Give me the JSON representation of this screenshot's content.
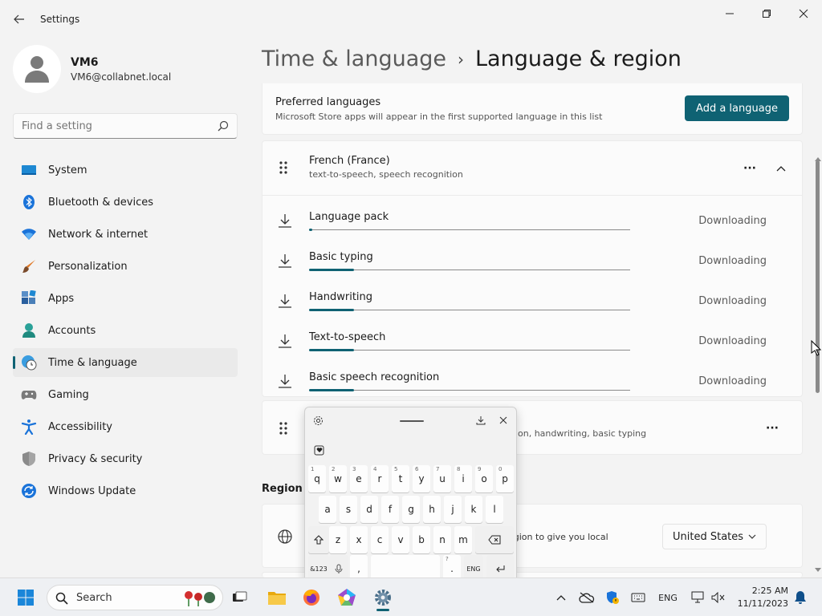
{
  "window": {
    "title": "Settings"
  },
  "profile": {
    "name": "VM6",
    "email": "VM6@collabnet.local"
  },
  "search": {
    "placeholder": "Find a setting"
  },
  "nav": {
    "items": [
      {
        "label": "System",
        "icon": "system-icon",
        "active": false
      },
      {
        "label": "Bluetooth & devices",
        "icon": "bluetooth-icon",
        "active": false
      },
      {
        "label": "Network & internet",
        "icon": "wifi-icon",
        "active": false
      },
      {
        "label": "Personalization",
        "icon": "brush-icon",
        "active": false
      },
      {
        "label": "Apps",
        "icon": "apps-icon",
        "active": false
      },
      {
        "label": "Accounts",
        "icon": "accounts-icon",
        "active": false
      },
      {
        "label": "Time & language",
        "icon": "globe-clock-icon",
        "active": true
      },
      {
        "label": "Gaming",
        "icon": "gamepad-icon",
        "active": false
      },
      {
        "label": "Accessibility",
        "icon": "accessibility-icon",
        "active": false
      },
      {
        "label": "Privacy & security",
        "icon": "shield-icon",
        "active": false
      },
      {
        "label": "Windows Update",
        "icon": "update-icon",
        "active": false
      }
    ]
  },
  "breadcrumb": {
    "parent": "Time & language",
    "separator": "›",
    "current": "Language & region"
  },
  "preferred": {
    "title": "Preferred languages",
    "subtitle": "Microsoft Store apps will appear in the first supported language in this list",
    "add_button": "Add a language"
  },
  "language1": {
    "name": "French (France)",
    "features": "text-to-speech, speech recognition",
    "more": "···",
    "downloads": [
      {
        "label": "Language pack",
        "status": "Downloading",
        "progress": 0.01
      },
      {
        "label": "Basic typing",
        "status": "Downloading",
        "progress": 0.14
      },
      {
        "label": "Handwriting",
        "status": "Downloading",
        "progress": 0.14
      },
      {
        "label": "Text-to-speech",
        "status": "Downloading",
        "progress": 0.14
      },
      {
        "label": "Basic speech recognition",
        "status": "Downloading",
        "progress": 0.14
      }
    ]
  },
  "language2": {
    "features": "on, handwriting, basic typing",
    "more": "···"
  },
  "region": {
    "label": "Region",
    "text": "egion to give you local",
    "country": "United States"
  },
  "keyboard": {
    "row1": [
      [
        "q",
        "1"
      ],
      [
        "w",
        "2"
      ],
      [
        "e",
        "3"
      ],
      [
        "r",
        "4"
      ],
      [
        "t",
        "5"
      ],
      [
        "y",
        "6"
      ],
      [
        "u",
        "7"
      ],
      [
        "i",
        "8"
      ],
      [
        "o",
        "9"
      ],
      [
        "p",
        "0"
      ]
    ],
    "row2": [
      "a",
      "s",
      "d",
      "f",
      "g",
      "h",
      "j",
      "k",
      "l"
    ],
    "row3": [
      "z",
      "x",
      "c",
      "v",
      "b",
      "n",
      "m"
    ],
    "symbols_key": "&123",
    "comma": ",",
    "period": ".",
    "period_hint": "?",
    "lang_key": "ENG"
  },
  "taskbar": {
    "search_label": "Search",
    "lang": "ENG",
    "time": "2:25 AM",
    "date": "11/11/2023"
  },
  "colors": {
    "accent": "#0f6273",
    "background": "#f3f3f3",
    "card": "#fbfbfb"
  }
}
